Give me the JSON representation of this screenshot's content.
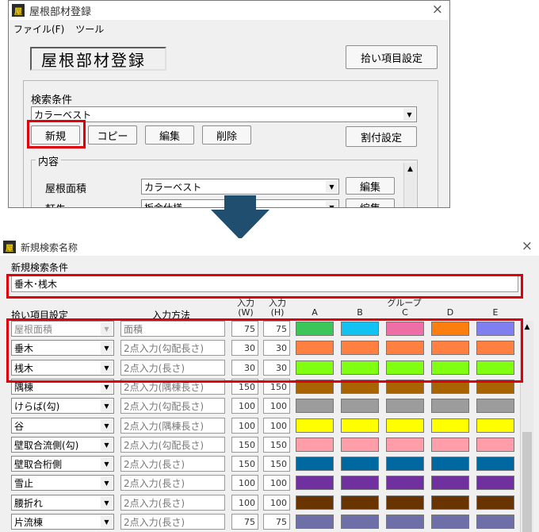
{
  "top_window": {
    "title": "屋根部材登録",
    "menu": [
      "ファイル(F)",
      "ツール"
    ],
    "heading": "屋根部材登録",
    "pick_settings_label": "拾い項目設定",
    "search_label": "検索条件",
    "search_value": "カラーベスト",
    "buttons": {
      "new": "新規",
      "copy": "コピー",
      "edit": "編集",
      "delete": "削除",
      "allocate": "割付設定"
    },
    "content_label": "内容",
    "rows": [
      {
        "label": "屋根面積",
        "value": "カラーベスト",
        "edit": "編集"
      },
      {
        "label": "軒先",
        "value": "板金仕様",
        "edit": "編集"
      }
    ]
  },
  "bottom_window": {
    "title": "新規検索名称",
    "new_condition_label": "新規検索条件",
    "new_condition_value": "垂木･桟木",
    "headers": {
      "pick_item": "拾い項目設定",
      "input_method": "入力方法",
      "w_top": "入力",
      "w_bottom": "(W)",
      "h_top": "入力",
      "h_bottom": "(H)",
      "group": "グループ",
      "cols": [
        "A",
        "B",
        "C",
        "D",
        "E"
      ]
    },
    "rows": [
      {
        "item": "屋根面積",
        "method": "面積",
        "w": "75",
        "h": "75",
        "item_disabled": true,
        "colors": [
          "#3cc65a",
          "#11c2f2",
          "#ee6fa6",
          "#fb7e0f",
          "#7f7ff0"
        ]
      },
      {
        "item": "垂木",
        "method": "2点入力(勾配長さ)",
        "w": "30",
        "h": "30",
        "item_disabled": false,
        "colors": [
          "#ff8040",
          "#ff8040",
          "#ff8040",
          "#ff8040",
          "#ff8040"
        ]
      },
      {
        "item": "桟木",
        "method": "2点入力(長さ)",
        "w": "30",
        "h": "30",
        "item_disabled": false,
        "colors": [
          "#80ff10",
          "#80ff10",
          "#80ff10",
          "#80ff10",
          "#80ff10"
        ]
      },
      {
        "item": "隅棟",
        "method": "2点入力(隅棟長さ)",
        "w": "150",
        "h": "150",
        "item_disabled": false,
        "colors": [
          "#a86400",
          "#a86400",
          "#a86400",
          "#a86400",
          "#a86400"
        ]
      },
      {
        "item": "けらば(勾)",
        "method": "2点入力(勾配長さ)",
        "w": "100",
        "h": "100",
        "item_disabled": false,
        "colors": [
          "#9c9c9c",
          "#9c9c9c",
          "#9c9c9c",
          "#9c9c9c",
          "#9c9c9c"
        ]
      },
      {
        "item": "谷",
        "method": "2点入力(隅棟長さ)",
        "w": "100",
        "h": "100",
        "item_disabled": false,
        "colors": [
          "#ffff00",
          "#ffff00",
          "#ffff00",
          "#ffff00",
          "#ffff00"
        ]
      },
      {
        "item": "壁取合流側(勾)",
        "method": "2点入力(勾配長さ)",
        "w": "150",
        "h": "150",
        "item_disabled": false,
        "colors": [
          "#ff9ea8",
          "#ff9ea8",
          "#ff9ea8",
          "#ff9ea8",
          "#ff9ea8"
        ]
      },
      {
        "item": "壁取合桁側",
        "method": "2点入力(長さ)",
        "w": "150",
        "h": "150",
        "item_disabled": false,
        "colors": [
          "#0068a0",
          "#0068a0",
          "#0068a0",
          "#0068a0",
          "#0068a0"
        ]
      },
      {
        "item": "雪止",
        "method": "2点入力(長さ)",
        "w": "100",
        "h": "100",
        "item_disabled": false,
        "colors": [
          "#7030a0",
          "#7030a0",
          "#7030a0",
          "#7030a0",
          "#7030a0"
        ]
      },
      {
        "item": "腰折れ",
        "method": "2点入力(長さ)",
        "w": "100",
        "h": "100",
        "item_disabled": false,
        "colors": [
          "#6a3400",
          "#6a3400",
          "#6a3400",
          "#6a3400",
          "#6a3400"
        ]
      },
      {
        "item": "片流棟",
        "method": "2点入力(長さ)",
        "w": "75",
        "h": "75",
        "item_disabled": false,
        "colors": [
          "#6e6ea8",
          "#6e6ea8",
          "#6e6ea8",
          "#6e6ea8",
          "#6e6ea8"
        ]
      }
    ]
  },
  "arrow_color": "#1f4e6e",
  "highlight_color": "#e0000b"
}
